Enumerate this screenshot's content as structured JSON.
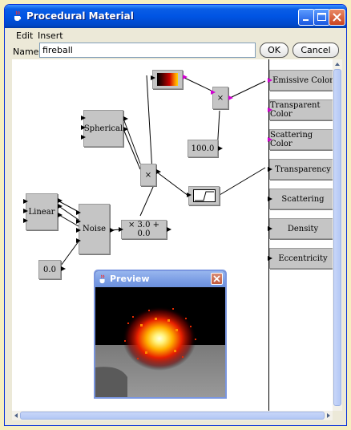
{
  "window": {
    "title": "Procedural Material"
  },
  "menu": {
    "items": [
      "Edit",
      "Insert"
    ]
  },
  "name_field": {
    "label": "Name:",
    "value": "fireball"
  },
  "buttons": {
    "ok": "OK",
    "cancel": "Cancel"
  },
  "nodes": {
    "spherical": "Spherical",
    "linear": "Linear",
    "noise": "Noise",
    "multiply_top": "×",
    "multiply_mid": "×",
    "scale": "× 3.0 + 0.0",
    "const_100": "100.0",
    "const_0": "0.0"
  },
  "outputs": [
    "Emissive Color",
    "Transparent Color",
    "Scattering Color",
    "Transparency",
    "Scattering",
    "Density",
    "Eccentricity"
  ],
  "preview": {
    "title": "Preview"
  },
  "colors": {
    "window_border": "#0831d9",
    "titlebar": "#0054e3",
    "node": "#c5c5c5",
    "port_color": "#d000d0",
    "port_scalar": "#000000",
    "background": "#f6efc0"
  }
}
